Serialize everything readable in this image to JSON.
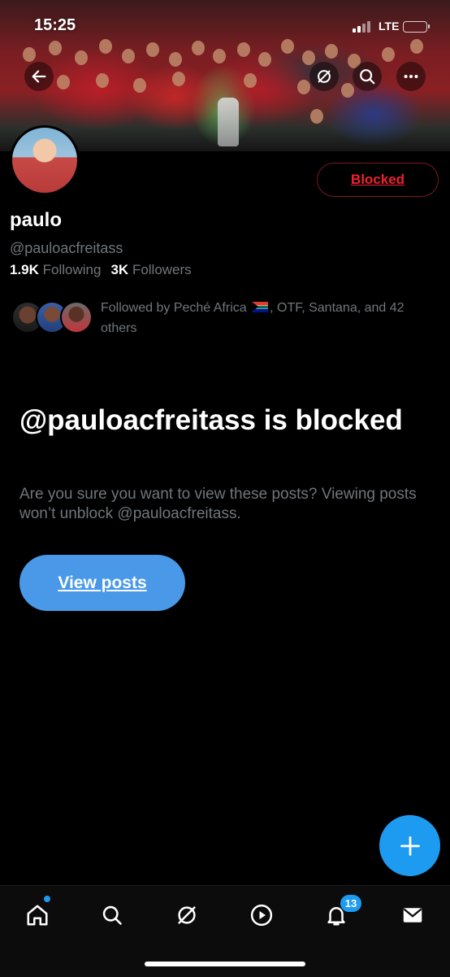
{
  "status_bar": {
    "time": "15:25",
    "network": "LTE"
  },
  "header": {
    "back_icon": "arrow-left-icon",
    "grok_icon": "grok-icon",
    "search_icon": "search-icon",
    "more_icon": "more-dots-icon"
  },
  "profile": {
    "name": "paulo",
    "handle": "@pauloacfreitass",
    "following_count": "1.9K",
    "following_label": "Following",
    "followers_count": "3K",
    "followers_label": "Followers",
    "blocked_label": "Blocked",
    "followed_by_prefix": "Followed by Peché Africa",
    "followed_by_rest": ", OTF, Santana, and 42 others"
  },
  "blocked_notice": {
    "title": "@pauloacfreitass is blocked",
    "description": "Are you sure you want to view these posts? Viewing posts won’t unblock @pauloacfreitass.",
    "view_posts_label": "View posts"
  },
  "fab": {
    "icon": "plus-icon"
  },
  "tab_bar": {
    "items": [
      {
        "name": "home",
        "icon": "home-icon"
      },
      {
        "name": "search",
        "icon": "search-icon"
      },
      {
        "name": "grok",
        "icon": "grok-icon"
      },
      {
        "name": "video",
        "icon": "play-icon"
      },
      {
        "name": "notifications",
        "icon": "bell-icon"
      },
      {
        "name": "messages",
        "icon": "mail-icon"
      }
    ],
    "notifications_badge": "13"
  },
  "colors": {
    "accent": "#1d9bf0",
    "view_button": "#4a99e9",
    "blocked_red": "#f4212e",
    "muted_text": "#71767b"
  }
}
